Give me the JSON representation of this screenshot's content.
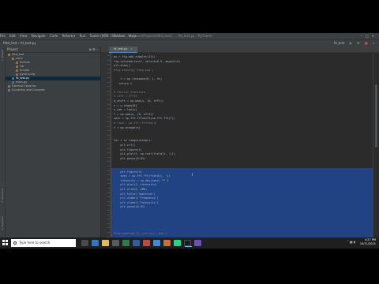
{
  "window": {
    "menu_items": [
      "File",
      "Edit",
      "View",
      "Navigate",
      "Code",
      "Refactor",
      "Run",
      "Tools",
      "VCS",
      "Window",
      "Help"
    ],
    "title": "fdtd_test [C:\\Users\\...\\PycharmProjects\\fdtd_test] - ...\\fd_test.py - PyCharm"
  },
  "navbar": {
    "breadcrumb": "fdtd_test  ›  fd_test.py",
    "run_config": "fd_test"
  },
  "project_panel": {
    "header": "Project",
    "tree": [
      {
        "label": "fdtd_test",
        "icon": "folder-icon",
        "indent": 0,
        "selected": false
      },
      {
        "label": "venv",
        "icon": "folder-icon",
        "indent": 1,
        "selected": false
      },
      {
        "label": "Include",
        "icon": "folder-icon",
        "indent": 2,
        "selected": false
      },
      {
        "label": "Lib",
        "icon": "folder-icon",
        "indent": 2,
        "selected": false
      },
      {
        "label": "Scripts",
        "icon": "folder-icon",
        "indent": 2,
        "selected": false
      },
      {
        "label": "pyvenv.cfg",
        "icon": "file-icon",
        "indent": 2,
        "selected": false
      },
      {
        "label": "fd_test.py",
        "icon": "python-file-icon",
        "indent": 1,
        "selected": true
      },
      {
        "label": "main.py",
        "icon": "python-file-icon",
        "indent": 1,
        "selected": false
      },
      {
        "label": "External Libraries",
        "icon": "library-icon",
        "indent": 0,
        "selected": false
      },
      {
        "label": "Scratches and Consoles",
        "icon": "scratch-icon",
        "indent": 0,
        "selected": false
      }
    ]
  },
  "editor": {
    "tab_label": "fd_test.py",
    "lines": [
      {
        "text": "ax = fig.add_subplot(111)",
        "style": "normal"
      },
      {
        "text": "fig.colorbar(surf, shrink=0.5, aspect=5)",
        "style": "normal"
      },
      {
        "text": "plt.show()",
        "style": "normal"
      },
      {
        "text": "#fig.savefig('temp.png')",
        "style": "comment"
      },
      {
        "text": "",
        "style": "normal"
      },
      {
        "text": "    t = np.linspace(0, 1, nt)",
        "style": "normal"
      },
      {
        "text": "   return t",
        "style": "normal"
      },
      {
        "text": "",
        "style": "normal"
      },
      {
        "text": "# Fourier transform",
        "style": "comment"
      },
      {
        "text": "# nfft = 2**12",
        "style": "comment"
      },
      {
        "text": "w_shift = np.pad(u, (0, nfft))",
        "style": "normal"
      },
      {
        "text": "n = u.shape[0]",
        "style": "normal"
      },
      {
        "text": "n_ssb = len(u)",
        "style": "normal"
      },
      {
        "text": "T = np.pad(u, (0, nfft))",
        "style": "normal"
      },
      {
        "text": "spec = np.fft.fftshift(np.fft.fft(T))",
        "style": "normal"
      },
      {
        "text": "# freq = np.fft.fftfreq(n)",
        "style": "comment"
      },
      {
        "text": "f = np.arange(n)",
        "style": "normal"
      },
      {
        "text": "",
        "style": "normal"
      },
      {
        "text": "",
        "style": "normal"
      },
      {
        "text": "for i in range(nsteps):",
        "style": "normal"
      },
      {
        "text": "    plt.clf()",
        "style": "normal"
      },
      {
        "text": "    plt.figure(1)",
        "style": "normal"
      },
      {
        "text": "    plt.plot(t, np.real(field[i, :]))",
        "style": "normal"
      },
      {
        "text": "    plt.pause(0.01)",
        "style": "normal"
      },
      {
        "text": "",
        "style": "normal"
      },
      {
        "text": "",
        "style": "normal"
      },
      {
        "text": "    plt.figure(2)",
        "style": "normal"
      },
      {
        "text": "    spec = np.fft.fft(field[i, :])",
        "style": "normal"
      },
      {
        "text": "    intensity = np.abs(spec) ** 2",
        "style": "normal"
      },
      {
        "text": "    plt.plot(f, intensity)",
        "style": "normal"
      },
      {
        "text": "    plt.xlim(0, 200)",
        "style": "normal"
      },
      {
        "text": "    plt.title('Spectrum')",
        "style": "normal"
      },
      {
        "text": "    plt.xlabel('Frequency')",
        "style": "normal"
      },
      {
        "text": "    plt.ylabel('Intensity')",
        "style": "normal"
      },
      {
        "text": "    plt.pause(0.01)",
        "style": "normal"
      },
      {
        "text": "",
        "style": "normal"
      },
      {
        "text": "",
        "style": "normal"
      },
      {
        "text": "",
        "style": "normal"
      },
      {
        "text": "",
        "style": "normal"
      },
      {
        "text": "",
        "style": "normal"
      },
      {
        "text": "#fig.savefig('E_'+str(i)+'.png')",
        "style": "comment"
      },
      {
        "text": "plt.show()",
        "style": "normal"
      }
    ]
  },
  "bottom_tools": {
    "left": [
      "TODO",
      "Problems",
      "Terminal",
      "Python Console"
    ],
    "right": "Event Log"
  },
  "statusbar": {
    "message": "",
    "info": "1087 chars, 33 line breaks   41:1   CRLF   UTF-8   4 spaces   Python 3.8"
  },
  "taskbar": {
    "search_placeholder": "Type here to search",
    "clock_time": "4:27 PM",
    "clock_date": "10/11/2021"
  },
  "colors": {
    "selection": "#214283",
    "editor_bg": "#2b2b2b",
    "panel_bg": "#3c3f41"
  }
}
